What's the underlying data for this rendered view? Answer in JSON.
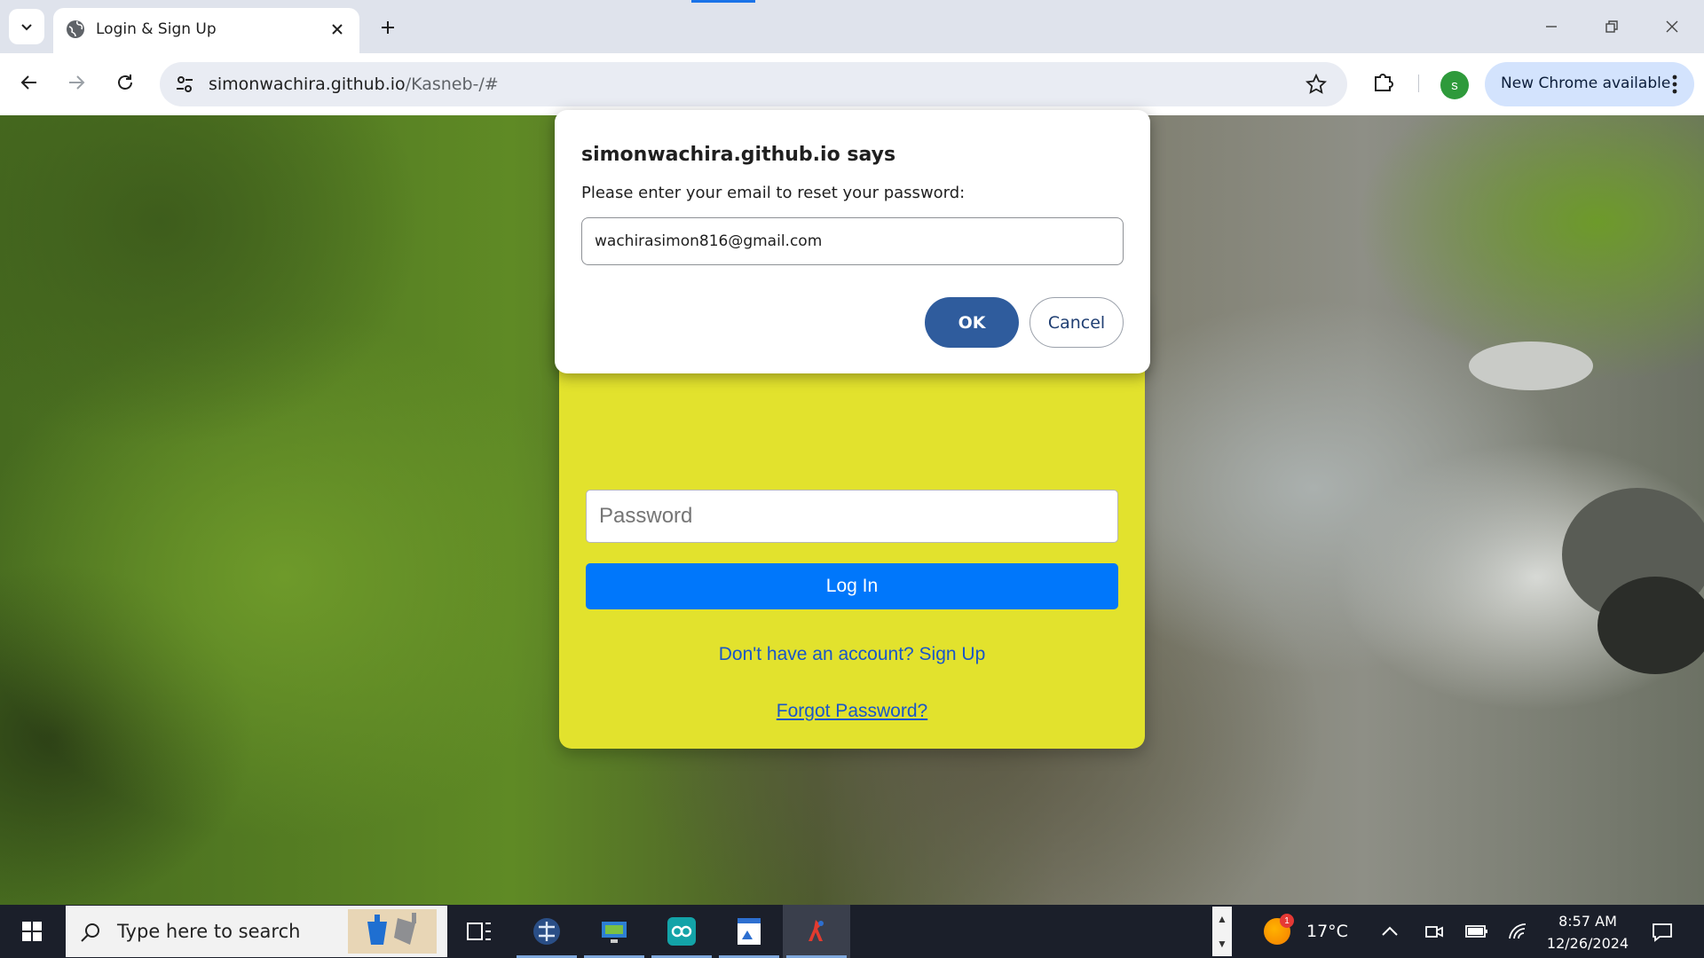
{
  "browser": {
    "tab": {
      "title": "Login & Sign Up"
    },
    "address": {
      "host": "simonwachira.github.io",
      "path": "/Kasneb-/#"
    },
    "profile_initial": "s",
    "update_label": "New Chrome available"
  },
  "page": {
    "password_placeholder": "Password",
    "login_label": "Log In",
    "signup_link": "Don't have an account? Sign Up",
    "forgot_link": "Forgot Password?"
  },
  "dialog": {
    "title": "simonwachira.github.io says",
    "message": "Please enter your email to reset your password:",
    "input_value": "wachirasimon816@gmail.com",
    "ok_label": "OK",
    "cancel_label": "Cancel"
  },
  "taskbar": {
    "search_placeholder": "Type here to search",
    "weather": {
      "temp": "17°C",
      "badge": "1"
    },
    "clock": {
      "time": "8:57 AM",
      "date": "12/26/2024"
    }
  },
  "colors": {
    "card": "#e2e22d",
    "login_button": "#0077fb",
    "ok_button": "#2f5c9d",
    "link": "#1a56c8"
  }
}
